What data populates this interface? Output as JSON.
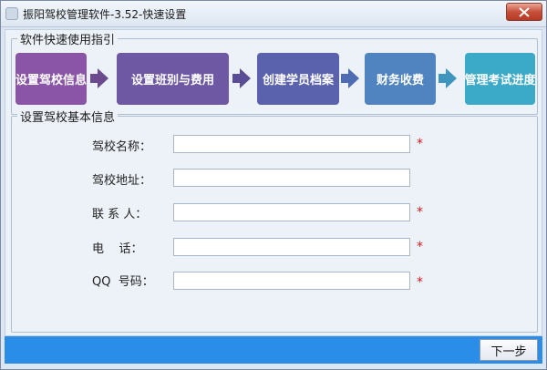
{
  "window": {
    "title": "振阳驾校管理软件-3.52-快速设置"
  },
  "guide": {
    "title": "软件快速使用指引",
    "steps": [
      {
        "label": "设置驾校信息",
        "color": "#8a55a6"
      },
      {
        "label": "设置班别与费用",
        "color": "#6e57a3"
      },
      {
        "label": "创建学员档案",
        "color": "#5a62ad"
      },
      {
        "label": "财务收费",
        "color": "#4f84c0"
      },
      {
        "label": "管理考试进度",
        "color": "#3ba9c8"
      }
    ],
    "arrow_colors": [
      "#6b4b8d",
      "#5a4c95",
      "#4e6cb1",
      "#3e95be"
    ]
  },
  "form": {
    "title": "设置驾校基本信息",
    "fields": [
      {
        "label": "驾校名称：",
        "value": "",
        "required_mark": "*"
      },
      {
        "label": "驾校地址：",
        "value": "",
        "required_mark": ""
      },
      {
        "label": "联 系 人：",
        "value": "",
        "required_mark": "*"
      },
      {
        "label": "电    话：",
        "value": "",
        "required_mark": "*"
      },
      {
        "label": "QQ  号码：",
        "value": "",
        "required_mark": "*"
      }
    ]
  },
  "footer": {
    "next_label": "下一步",
    "bar_color": "#2a8de7"
  }
}
